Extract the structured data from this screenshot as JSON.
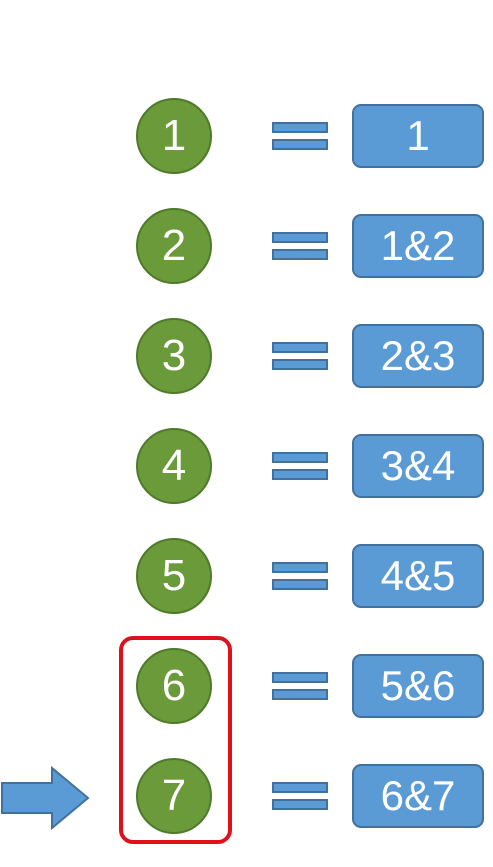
{
  "rows": [
    {
      "number": "1",
      "result": "1"
    },
    {
      "number": "2",
      "result": "1&2"
    },
    {
      "number": "3",
      "result": "2&3"
    },
    {
      "number": "4",
      "result": "3&4"
    },
    {
      "number": "5",
      "result": "4&5"
    },
    {
      "number": "6",
      "result": "5&6"
    },
    {
      "number": "7",
      "result": "6&7"
    }
  ],
  "colors": {
    "circle_fill": "#6a9a3a",
    "circle_border": "#4e7a29",
    "box_fill": "#5b9bd5",
    "box_border": "#41719c",
    "highlight": "#e0101a"
  },
  "highlight": {
    "rows": [
      "6",
      "7"
    ]
  },
  "pointer": {
    "points_to_row": "7",
    "icon": "right-arrow-icon"
  }
}
